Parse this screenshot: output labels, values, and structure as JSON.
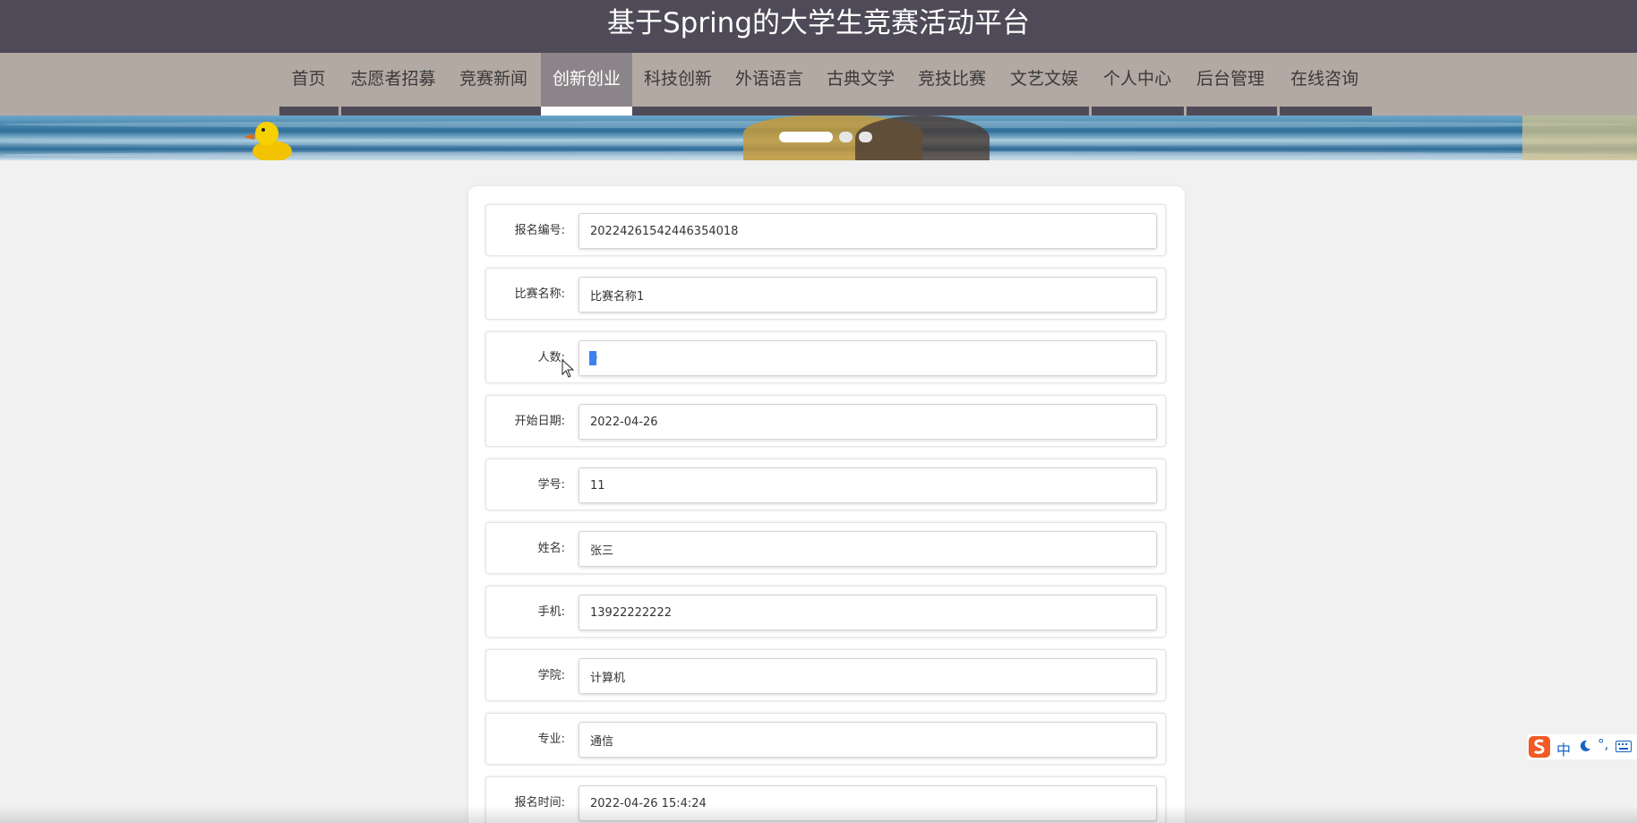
{
  "header": {
    "title": "基于Spring的大学生竞赛活动平台"
  },
  "nav": {
    "items": [
      {
        "label": "首页"
      },
      {
        "label": "志愿者招募"
      },
      {
        "label": "竞赛新闻"
      },
      {
        "label": "创新创业",
        "active": true
      },
      {
        "label": "科技创新"
      },
      {
        "label": "外语语言"
      },
      {
        "label": "古典文学"
      },
      {
        "label": "竞技比赛"
      },
      {
        "label": "文艺文娱"
      },
      {
        "label": "个人中心"
      },
      {
        "label": "后台管理"
      },
      {
        "label": "在线咨询"
      }
    ]
  },
  "carousel": {
    "slide_count": 3,
    "active_index": 0
  },
  "form": {
    "fields": [
      {
        "label": "报名编号:",
        "value": "20224261542446354018"
      },
      {
        "label": "比赛名称:",
        "value": "比赛名称1"
      },
      {
        "label": "人数:",
        "value": "0"
      },
      {
        "label": "开始日期:",
        "value": "2022-04-26"
      },
      {
        "label": "学号:",
        "value": "11"
      },
      {
        "label": "姓名:",
        "value": "张三"
      },
      {
        "label": "手机:",
        "value": "13922222222"
      },
      {
        "label": "学院:",
        "value": "计算机"
      },
      {
        "label": "专业:",
        "value": "通信"
      },
      {
        "label": "报名时间:",
        "value": "2022-04-26 15:4:24"
      }
    ]
  },
  "ime": {
    "mode_label": "中",
    "punct_label": "°,"
  },
  "colors": {
    "header_bg": "#4f4a57",
    "nav_bg": "#b3a9a3",
    "nav_active_bg": "#8b8489",
    "page_bg": "#f1f1f1",
    "selection": "#3b82f0"
  }
}
